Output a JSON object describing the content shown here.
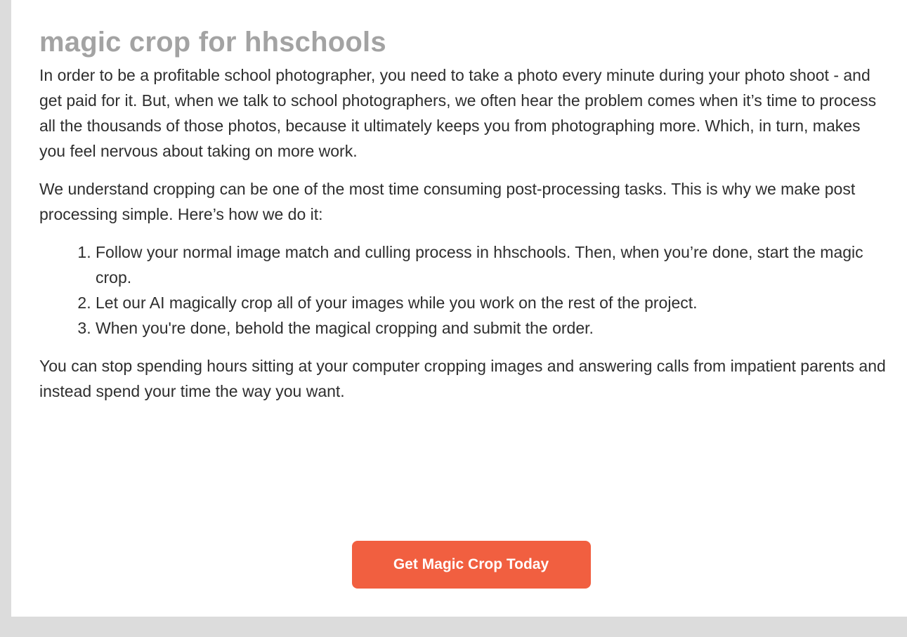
{
  "article": {
    "title": "magic crop for hhschools",
    "paragraphs": [
      "In order to be a profitable school photographer, you need to take a photo every minute during your photo shoot - and get paid for it. But, when we talk to school photographers, we often hear the problem comes when it’s time to process all the thousands of those photos, because it ultimately keeps you from photographing more. Which, in turn, makes you feel nervous about taking on more work.",
      "We understand cropping can be one of the most time consuming post-processing tasks. This is why we make post processing simple. Here’s how we do it:"
    ],
    "steps": [
      "Follow your normal image match and culling process in hhschools. Then, when you’re done, start the magic crop.",
      "Let our AI magically crop all of your images while you work on the rest of the project.",
      "When you're done, behold the magical cropping and submit the order."
    ],
    "closing": "You can stop spending hours sitting at your computer cropping images and answering calls from impatient parents and instead spend your time the way you want."
  },
  "cta": {
    "label": "Get Magic Crop Today"
  },
  "colors": {
    "page_background": "#dcdcdc",
    "card_background": "#ffffff",
    "title": "#a3a3a3",
    "body_text": "#2e2e2e",
    "cta_background": "#f15f40",
    "cta_text": "#ffffff"
  }
}
